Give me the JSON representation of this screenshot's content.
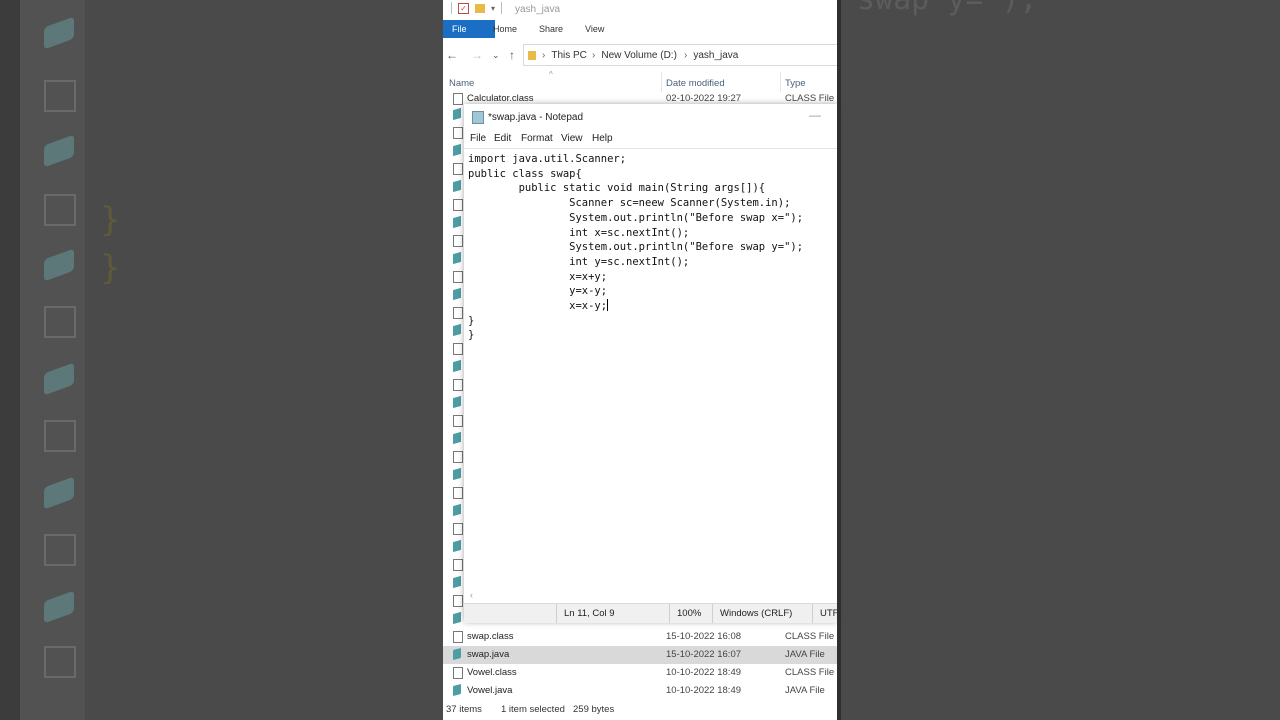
{
  "explorer": {
    "window_title": "yash_java",
    "ribbon": {
      "file": "File",
      "home": "Home",
      "share": "Share",
      "view": "View"
    },
    "address": {
      "crumbs": [
        "This PC",
        "New Volume (D:)",
        "yash_java"
      ]
    },
    "columns": {
      "name": "Name",
      "date": "Date modified",
      "type": "Type"
    },
    "top_row": {
      "name": "Calculator.class",
      "date": "02-10-2022 19:27",
      "type": "CLASS File"
    },
    "rows": [
      {
        "name": "swap.class",
        "date": "15-10-2022 16:08",
        "type": "CLASS File",
        "icon": "class-file-icon",
        "selected": false
      },
      {
        "name": "swap.java",
        "date": "15-10-2022 16:07",
        "type": "JAVA File",
        "icon": "java-file-icon",
        "selected": true
      },
      {
        "name": "Vowel.class",
        "date": "10-10-2022 18:49",
        "type": "CLASS File",
        "icon": "class-file-icon",
        "selected": false
      },
      {
        "name": "Vowel.java",
        "date": "10-10-2022 18:49",
        "type": "JAVA File",
        "icon": "java-file-icon",
        "selected": false
      }
    ],
    "status": {
      "count": "37 items",
      "selection": "1 item selected",
      "size": "259 bytes"
    }
  },
  "notepad": {
    "title": "*swap.java - Notepad",
    "menu": {
      "file": "File",
      "edit": "Edit",
      "format": "Format",
      "view": "View",
      "help": "Help"
    },
    "code": "import java.util.Scanner;\npublic class swap{\n        public static void main(String args[]){\n                Scanner sc=neew Scanner(System.in);\n                System.out.println(\"Before swap x=\");\n                int x=sc.nextInt();\n                System.out.println(\"Before swap y=\");\n                int y=sc.nextInt();\n                x=x+y;\n                y=x-y;\n                x=x-y;",
    "code_tail": "\n}\n}",
    "status": {
      "position": "Ln 11, Col 9",
      "zoom": "100%",
      "line_ending": "Windows (CRLF)",
      "encoding": "UTF"
    }
  },
  "background": {
    "left_braces": [
      "}",
      "}"
    ],
    "right_text": "swap y=\");"
  }
}
